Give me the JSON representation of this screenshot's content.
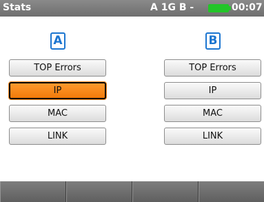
{
  "status_bar": {
    "title": "Stats",
    "ports": "A 1G B -",
    "battery_color": "#22c528",
    "time": "00:07"
  },
  "port_a": {
    "badge": "A",
    "buttons": [
      "TOP Errors",
      "IP",
      "MAC",
      "LINK"
    ],
    "selected_index": 1
  },
  "port_b": {
    "badge": "B",
    "buttons": [
      "TOP Errors",
      "IP",
      "MAC",
      "LINK"
    ]
  },
  "colors": {
    "badge_blue": "#1b75d0",
    "selected_orange": "#f5841f",
    "bar_gray": "#707070"
  },
  "softkeys": [
    "",
    "",
    "",
    ""
  ]
}
